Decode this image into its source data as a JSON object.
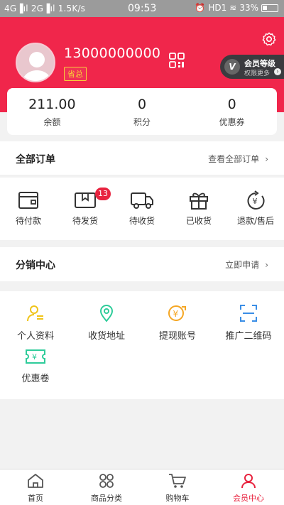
{
  "status_bar": {
    "left": "4G▐ıl 2G▐ıl 1.5K/s",
    "time": "09:53",
    "right": "HD1",
    "battery": "33%"
  },
  "profile": {
    "phone": "13000000000",
    "rank": "省总",
    "vip_title": "会员等级",
    "vip_sub": "权限更多"
  },
  "stats": [
    {
      "value": "211.00",
      "label": "余额"
    },
    {
      "value": "0",
      "label": "积分"
    },
    {
      "value": "0",
      "label": "优惠券"
    }
  ],
  "orders_section": {
    "title": "全部订单",
    "more": "查看全部订单"
  },
  "orders": [
    {
      "label": "待付款",
      "icon": "wallet-icon"
    },
    {
      "label": "待发货",
      "icon": "package-icon",
      "badge": "13"
    },
    {
      "label": "待收货",
      "icon": "truck-icon"
    },
    {
      "label": "已收货",
      "icon": "gift-icon"
    },
    {
      "label": "退款/售后",
      "icon": "refund-icon"
    }
  ],
  "distribution": {
    "title": "分销中心",
    "more": "立即申请"
  },
  "tools": [
    {
      "label": "个人资料",
      "icon": "user-profile-icon"
    },
    {
      "label": "收货地址",
      "icon": "location-pin-icon"
    },
    {
      "label": "提现账号",
      "icon": "withdraw-icon"
    },
    {
      "label": "推广二维码",
      "icon": "scan-qr-icon"
    },
    {
      "label": "优惠卷",
      "icon": "coupon-icon"
    }
  ],
  "tabs": [
    {
      "label": "首页",
      "icon": "home-icon"
    },
    {
      "label": "商品分类",
      "icon": "category-icon"
    },
    {
      "label": "购物车",
      "icon": "cart-icon"
    },
    {
      "label": "会员中心",
      "icon": "member-icon",
      "active": true
    }
  ],
  "colors": {
    "brand": "#f0264b",
    "accent_icon_yellow": "#f0c419",
    "accent_icon_green": "#2ecc9a",
    "accent_icon_orange": "#f5a623",
    "accent_icon_blue": "#3a8ee6"
  }
}
